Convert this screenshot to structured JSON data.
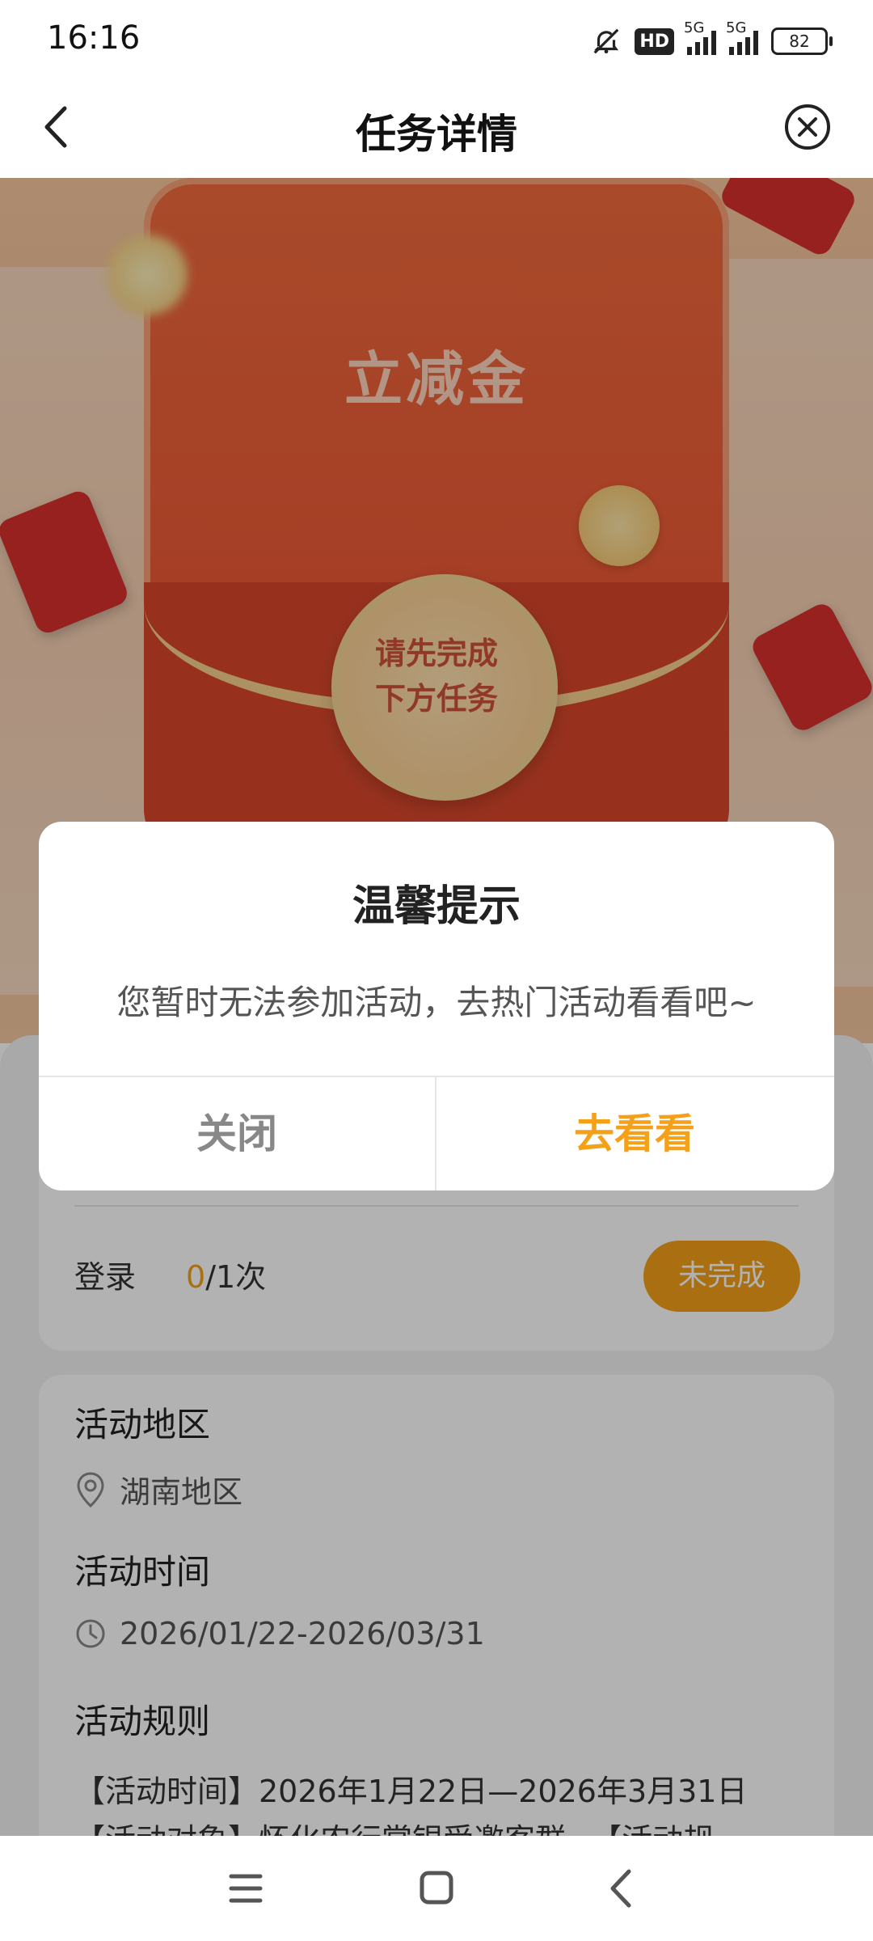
{
  "status_bar": {
    "time": "16:16",
    "hd_badge": "HD",
    "network_1": "5G",
    "network_2": "5G",
    "battery": "82",
    "icons": [
      "mute-icon",
      "hd-icon",
      "signal-icon",
      "signal-icon",
      "battery-icon"
    ]
  },
  "header": {
    "title": "任务详情",
    "back_icon": "chevron-left-icon",
    "close_icon": "close-circle-icon"
  },
  "banner": {
    "title": "立减金",
    "coin_text_line1": "请先完成",
    "coin_text_line2": "下方任务"
  },
  "dialog": {
    "title": "温馨提示",
    "message": "您暂时无法参加活动，去热门活动看看吧~",
    "close_label": "关闭",
    "go_label": "去看看",
    "accent_color": "#f4a019"
  },
  "task": {
    "label": "登录",
    "progress_done": "0",
    "progress_rest": "/1次",
    "status": "未完成"
  },
  "info": {
    "region_title": "活动地区",
    "region_value": "湖南地区",
    "time_title": "活动时间",
    "time_value": "2026/01/22-2026/03/31",
    "rules_title": "活动规则",
    "rules_line1": "【活动时间】2026年1月22日—2026年3月31日",
    "rules_line2": "【活动对象】怀化农行掌银受邀客群 。【活动规"
  },
  "navbar": {
    "icons": [
      "menu-icon",
      "home-icon",
      "back-icon"
    ]
  }
}
